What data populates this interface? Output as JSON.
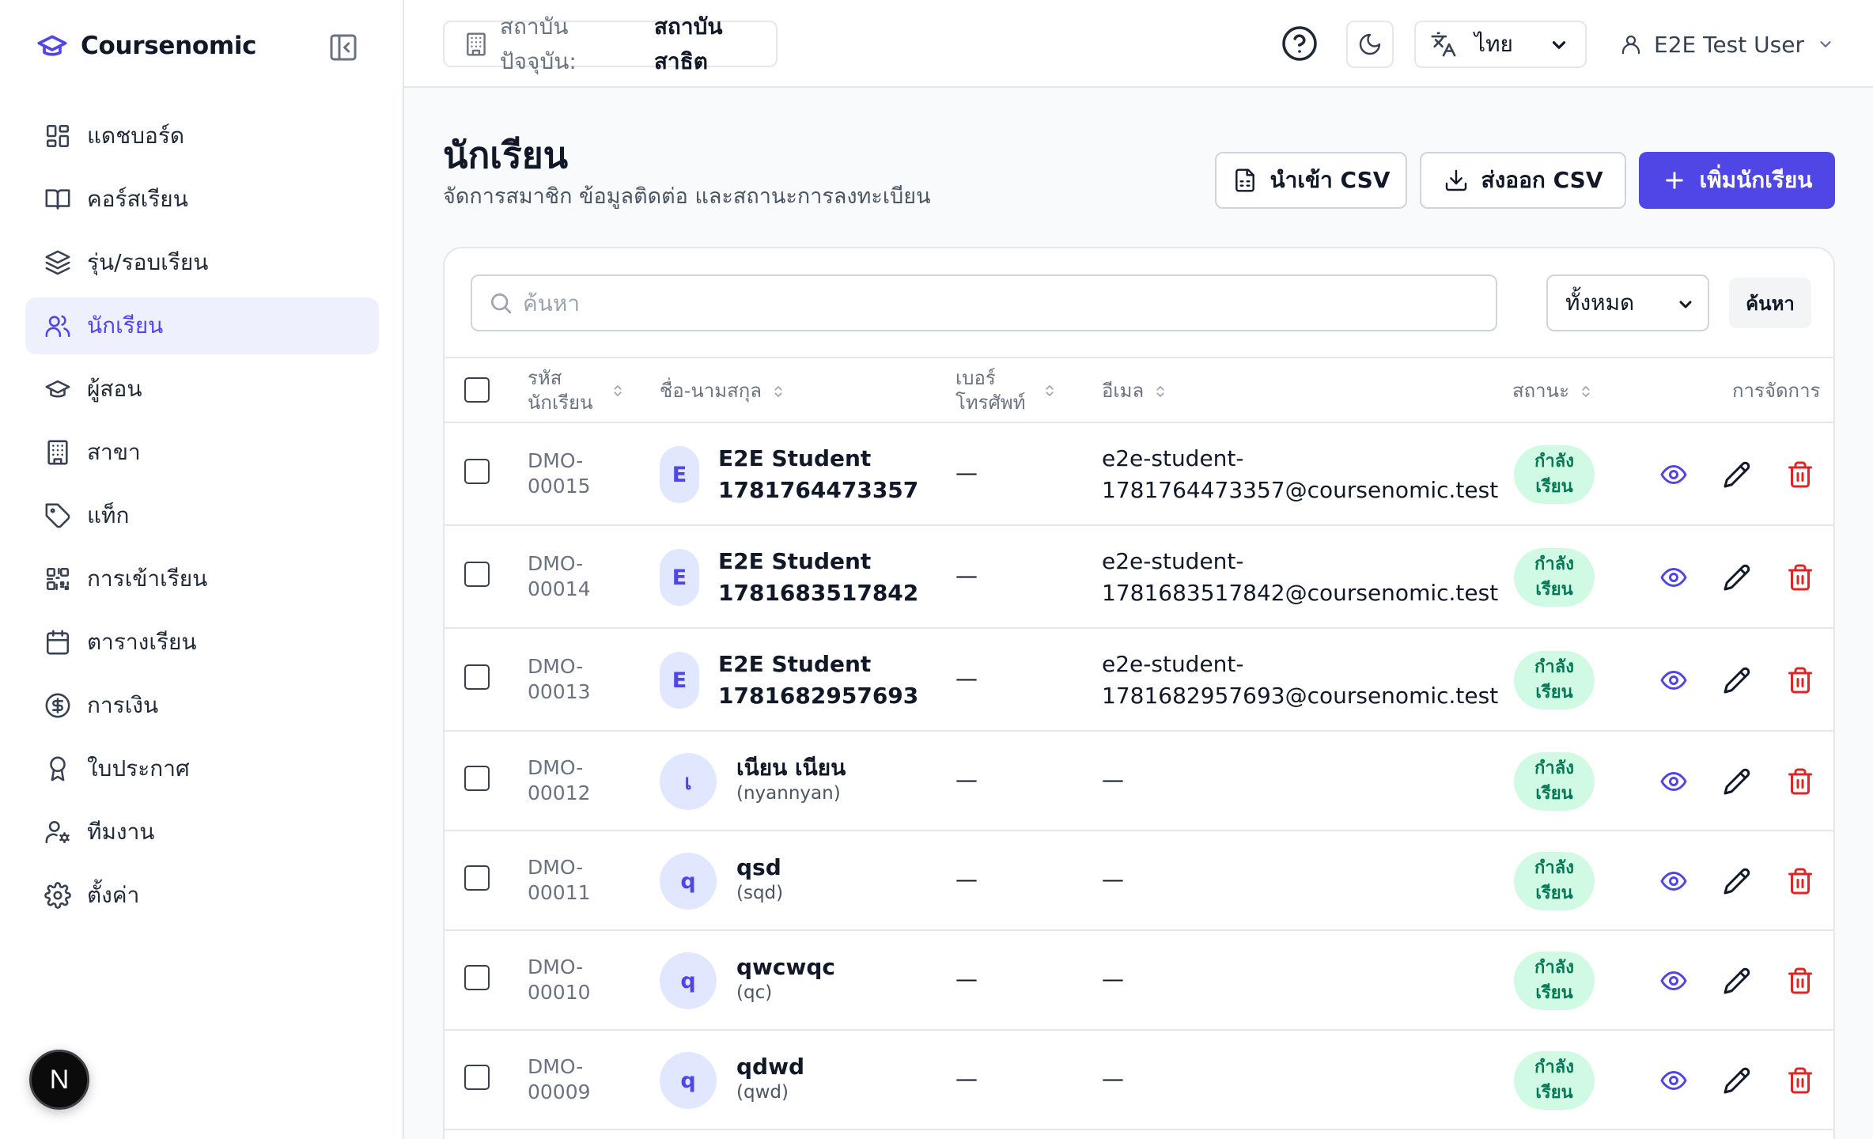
{
  "brand": {
    "name": "Coursenomic"
  },
  "sidebar": {
    "items": [
      {
        "label": "แดชบอร์ด",
        "icon": "dashboard-icon"
      },
      {
        "label": "คอร์สเรียน",
        "icon": "book-icon"
      },
      {
        "label": "รุ่น/รอบเรียน",
        "icon": "layers-icon"
      },
      {
        "label": "นักเรียน",
        "icon": "users-icon",
        "active": true
      },
      {
        "label": "ผู้สอน",
        "icon": "graduation-cap-icon"
      },
      {
        "label": "สาขา",
        "icon": "building-icon"
      },
      {
        "label": "แท็ก",
        "icon": "tag-icon"
      },
      {
        "label": "การเข้าเรียน",
        "icon": "qr-code-icon"
      },
      {
        "label": "ตารางเรียน",
        "icon": "calendar-icon"
      },
      {
        "label": "การเงิน",
        "icon": "dollar-circle-icon"
      },
      {
        "label": "ใบประกาศ",
        "icon": "award-icon"
      },
      {
        "label": "ทีมงาน",
        "icon": "user-cog-icon"
      },
      {
        "label": "ตั้งค่า",
        "icon": "gear-icon"
      }
    ],
    "next_badge": "N"
  },
  "topbar": {
    "branch_label": "สถาบันปัจจุบัน:",
    "branch_value": "สถาบันสาธิต",
    "language": "ไทย",
    "user_name": "E2E Test User"
  },
  "page": {
    "title": "นักเรียน",
    "subtitle": "จัดการสมาชิก ข้อมูลติดต่อ และสถานะการลงทะเบียน",
    "import_label": "นำเข้า CSV",
    "export_label": "ส่งออก CSV",
    "add_label": "เพิ่มนักเรียน"
  },
  "filters": {
    "search_placeholder": "ค้นหา",
    "status_value": "ทั้งหมด",
    "search_button": "ค้นหา"
  },
  "table": {
    "headers": {
      "code_1": "รหัส",
      "code_2": "นักเรียน",
      "name": "ชื่อ-นามสกุล",
      "phone_1": "เบอร์",
      "phone_2": "โทรศัพท์",
      "email": "อีเมล",
      "status": "สถานะ",
      "actions": "การจัดการ"
    },
    "rows": [
      {
        "code_1": "DMO-",
        "code_2": "00015",
        "avatar": "E",
        "name_1": "E2E Student",
        "name_2": "1781764473357",
        "phone": "—",
        "email_1": "e2e-student-",
        "email_2": "1781764473357@coursenomic.test",
        "status_1": "กำลัง",
        "status_2": "เรียน"
      },
      {
        "code_1": "DMO-",
        "code_2": "00014",
        "avatar": "E",
        "name_1": "E2E Student",
        "name_2": "1781683517842",
        "phone": "—",
        "email_1": "e2e-student-",
        "email_2": "1781683517842@coursenomic.test",
        "status_1": "กำลัง",
        "status_2": "เรียน"
      },
      {
        "code_1": "DMO-",
        "code_2": "00013",
        "avatar": "E",
        "name_1": "E2E Student",
        "name_2": "1781682957693",
        "phone": "—",
        "email_1": "e2e-student-",
        "email_2": "1781682957693@coursenomic.test",
        "status_1": "กำลัง",
        "status_2": "เรียน"
      },
      {
        "code_1": "DMO-",
        "code_2": "00012",
        "avatar": "เ",
        "name_1": "เนียน เนียน",
        "name_2": "(nyannyan)",
        "phone": "—",
        "email": "—",
        "status_1": "กำลัง",
        "status_2": "เรียน"
      },
      {
        "code_1": "DMO-",
        "code_2": "00011",
        "avatar": "q",
        "name_1": "qsd",
        "name_2": "(sqd)",
        "phone": "—",
        "email": "—",
        "status_1": "กำลัง",
        "status_2": "เรียน"
      },
      {
        "code_1": "DMO-",
        "code_2": "00010",
        "avatar": "q",
        "name_1": "qwcwqc",
        "name_2": "(qc)",
        "phone": "—",
        "email": "—",
        "status_1": "กำลัง",
        "status_2": "เรียน"
      },
      {
        "code_1": "DMO-",
        "code_2": "00009",
        "avatar": "q",
        "name_1": "qdwd",
        "name_2": "(qwd)",
        "phone": "—",
        "email": "—",
        "status_1": "กำลัง",
        "status_2": "เรียน"
      }
    ]
  },
  "colors": {
    "accent": "#4f46e5",
    "active_bg": "#eef0fe",
    "status_bg": "#d1fae5",
    "status_text": "#047857",
    "danger": "#dc2626"
  }
}
